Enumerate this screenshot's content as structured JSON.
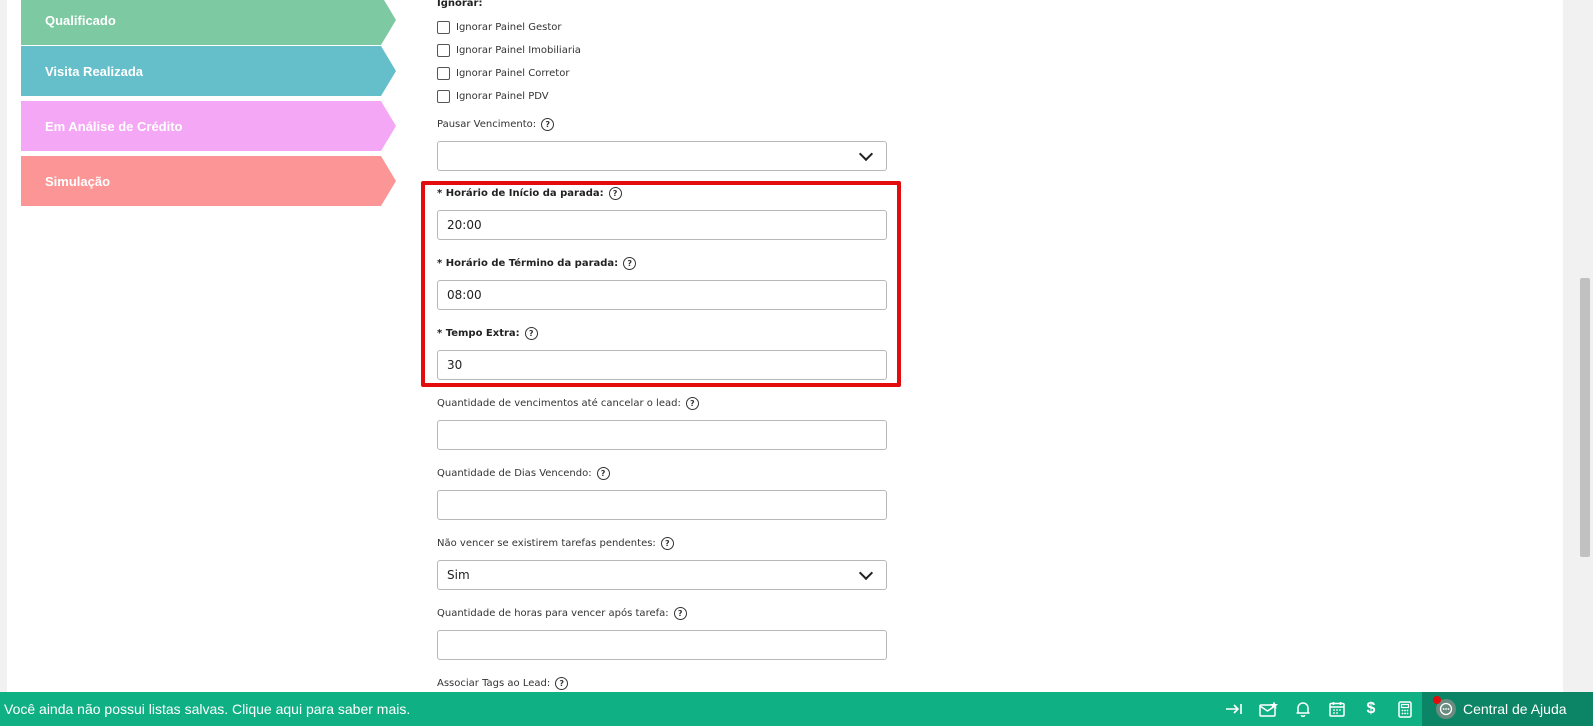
{
  "stages": [
    {
      "label": "Qualificado",
      "color": "#7dc9a2"
    },
    {
      "label": "Visita Realizada",
      "color": "#65bfcb"
    },
    {
      "label": "Em Análise de Crédito",
      "color": "#f4a7f4"
    },
    {
      "label": "Simulação",
      "color": "#fb9596"
    }
  ],
  "form": {
    "ignore_label": "Ignorar:",
    "checkboxes": [
      "Ignorar Painel Gestor",
      "Ignorar Painel Imobiliaria",
      "Ignorar Painel Corretor",
      "Ignorar Painel PDV"
    ],
    "pause_label": "Pausar Vencimento:",
    "pause_value": "",
    "start_label": "* Horário de Início da parada:",
    "start_value": "20:00",
    "end_label": "* Horário de Término da parada:",
    "end_value": "08:00",
    "extra_label": "* Tempo Extra:",
    "extra_value": "30",
    "qty_due_label": "Quantidade de vencimentos até cancelar o lead:",
    "qty_due_value": "",
    "days_label": "Quantidade de Dias Vencendo:",
    "days_value": "",
    "pending_label": "Não vencer se existirem tarefas pendentes:",
    "pending_value": "Sim",
    "hours_label": "Quantidade de horas para vencer após tarefa:",
    "hours_value": "",
    "tags_label": "Associar Tags ao Lead:"
  },
  "help_glyph": "?",
  "bottom_bar": {
    "message": "Você ainda não possui listas salvas. Clique aqui para saber mais.",
    "icons": [
      "collapse-icon",
      "mail-star-icon",
      "bell-icon",
      "calendar-icon",
      "dollar-icon",
      "calculator-icon"
    ],
    "dollar": "$",
    "help_center": "Central de Ajuda"
  },
  "colors": {
    "bottom_bar": "#10b085",
    "help_center": "#0b8565",
    "highlight": "#e30b0b"
  }
}
